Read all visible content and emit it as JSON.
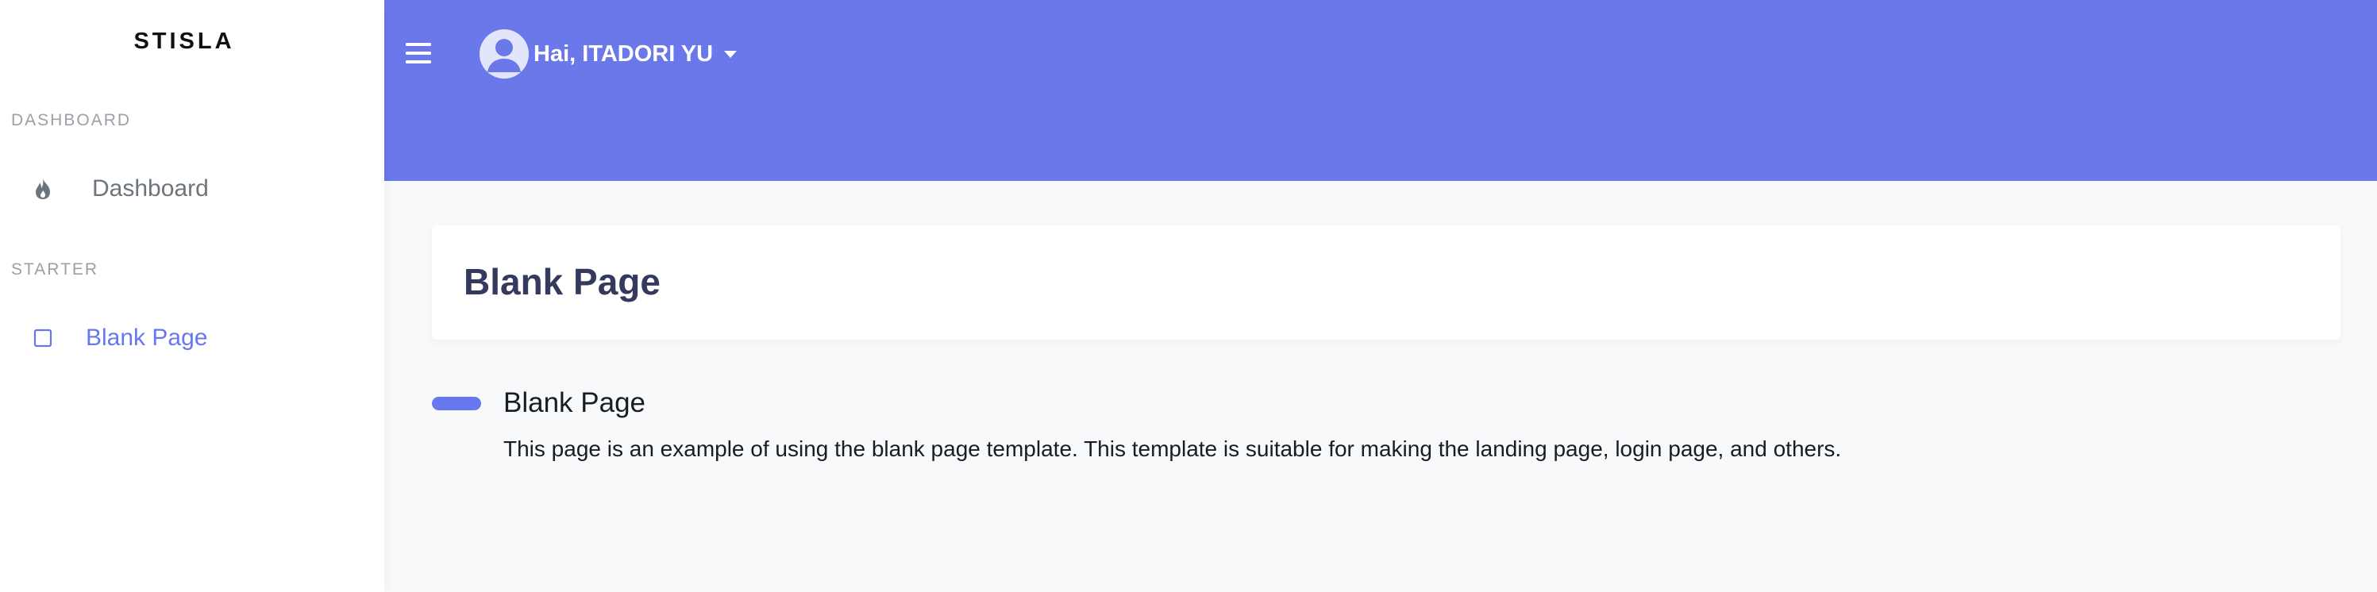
{
  "sidebar": {
    "brand": "STISLA",
    "sections": [
      {
        "header": "DASHBOARD",
        "items": [
          {
            "label": "Dashboard",
            "icon": "fire-icon",
            "active": false
          }
        ]
      },
      {
        "header": "STARTER",
        "items": [
          {
            "label": "Blank Page",
            "icon": "square-icon",
            "active": true
          }
        ]
      }
    ]
  },
  "navbar": {
    "menu_icon": "hamburger-icon",
    "user_name": "Hai, ITADORI YU",
    "avatar_icon": "user-avatar-icon",
    "dropdown_icon": "caret-down-icon"
  },
  "main": {
    "page_title": "Blank Page",
    "section_title": "Blank Page",
    "section_text": "This page is an example of using the blank page template. This template is suitable for making the landing page, login page, and others."
  },
  "colors": {
    "primary": "#6777ef",
    "navbar_bg": "#6a78ea",
    "page_bg": "#f8f9fb",
    "title_text": "#34395e",
    "muted_text": "#6c757d"
  }
}
